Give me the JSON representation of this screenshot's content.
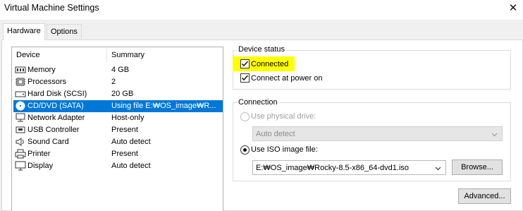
{
  "window": {
    "title": "Virtual Machine Settings"
  },
  "tabs": [
    {
      "label": "Hardware",
      "active": true
    },
    {
      "label": "Options",
      "active": false
    }
  ],
  "device_list": {
    "headers": {
      "device": "Device",
      "summary": "Summary"
    },
    "rows": [
      {
        "name": "Memory",
        "summary": "4 GB",
        "icon": "memory-icon",
        "selected": false
      },
      {
        "name": "Processors",
        "summary": "2",
        "icon": "processor-icon",
        "selected": false
      },
      {
        "name": "Hard Disk (SCSI)",
        "summary": "20 GB",
        "icon": "hard-disk-icon",
        "selected": false
      },
      {
        "name": "CD/DVD (SATA)",
        "summary": "Using file E:₩OS_image₩R...",
        "icon": "cd-dvd-icon",
        "selected": true
      },
      {
        "name": "Network Adapter",
        "summary": "Host-only",
        "icon": "network-adapter-icon",
        "selected": false
      },
      {
        "name": "USB Controller",
        "summary": "Present",
        "icon": "usb-controller-icon",
        "selected": false
      },
      {
        "name": "Sound Card",
        "summary": "Auto detect",
        "icon": "sound-card-icon",
        "selected": false
      },
      {
        "name": "Printer",
        "summary": "Present",
        "icon": "printer-icon",
        "selected": false
      },
      {
        "name": "Display",
        "summary": "Auto detect",
        "icon": "display-icon",
        "selected": false
      }
    ]
  },
  "device_status": {
    "label": "Device status",
    "connected": {
      "label": "Connected",
      "checked": true,
      "highlighted": true
    },
    "connect_at_power_on": {
      "label": "Connect at power on",
      "checked": true
    }
  },
  "connection": {
    "label": "Connection",
    "physical_drive": {
      "label": "Use physical drive:",
      "selected": false,
      "enabled": false
    },
    "physical_drive_select": {
      "value": "Auto detect",
      "enabled": false
    },
    "iso_image": {
      "label": "Use ISO image file:",
      "selected": true,
      "enabled": true
    },
    "iso_path": {
      "value": "E:₩OS_image₩Rocky-8.5-x86_64-dvd1.iso"
    },
    "browse_label": "Browse..."
  },
  "advanced_label": "Advanced...",
  "colors": {
    "selection": "#0078d7",
    "highlight": "#ffff00",
    "dialog_background": "#f0f0f0"
  }
}
